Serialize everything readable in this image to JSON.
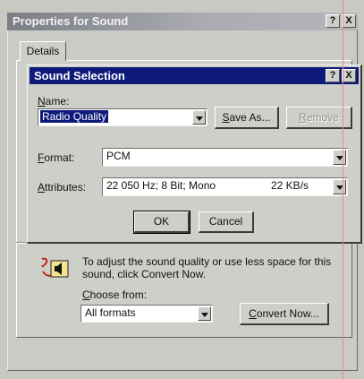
{
  "back_window": {
    "title": "Properties for Sound",
    "help_btn": "?",
    "close_btn": "X",
    "tab": "Details"
  },
  "dialog": {
    "title": "Sound Selection",
    "help_btn": "?",
    "close_btn": "X",
    "name_label": "Name:",
    "name_value": "Radio Quality",
    "save_as": "Save As...",
    "remove": "Remove",
    "format_label": "Format:",
    "format_value": "PCM",
    "attributes_label": "Attributes:",
    "attributes_value": "22 050 Hz; 8 Bit; Mono",
    "attributes_rate": "22 KB/s",
    "ok": "OK",
    "cancel": "Cancel"
  },
  "convert": {
    "info": "To adjust the sound quality or use less space for this sound, click Convert Now.",
    "choose_label": "Choose from:",
    "choose_value": "All formats",
    "convert_now": "Convert Now..."
  }
}
